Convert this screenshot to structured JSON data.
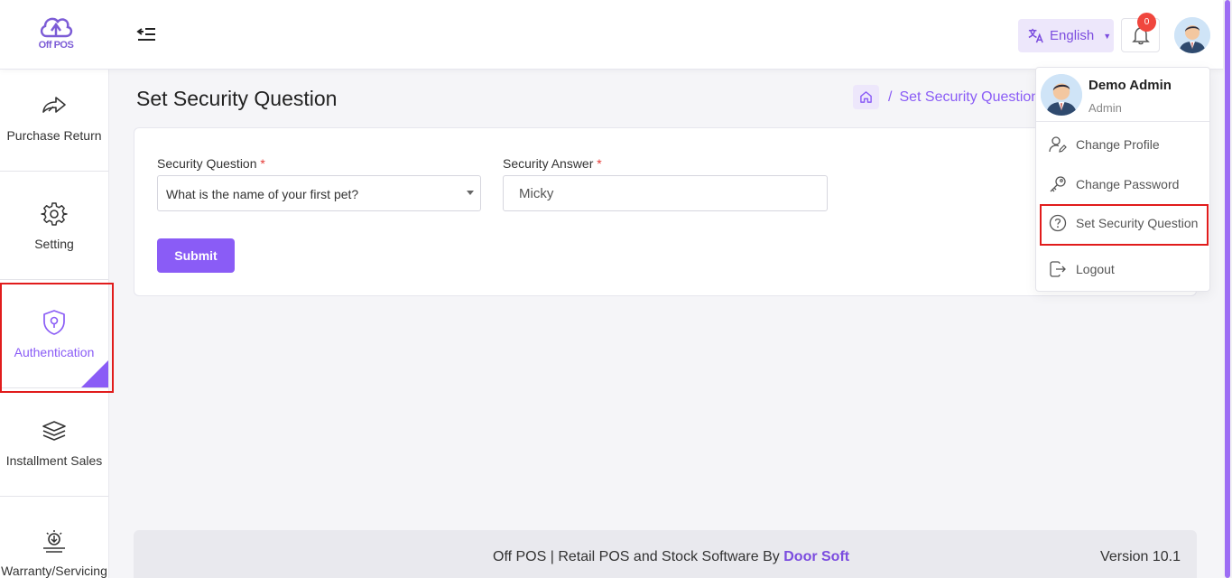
{
  "app": {
    "logo_text": "Off POS"
  },
  "header": {
    "language_label": "English",
    "notification_count": "0"
  },
  "sidebar": {
    "items": [
      {
        "label": "Purchase Return",
        "icon": "share-arrow-icon"
      },
      {
        "label": "Setting",
        "icon": "gear-icon"
      },
      {
        "label": "Authentication",
        "icon": "shield-key-icon",
        "active": true
      },
      {
        "label": "Installment Sales",
        "icon": "coins-stack-icon"
      },
      {
        "label": "Warranty/Servicing",
        "icon": "service-icon"
      }
    ]
  },
  "page": {
    "title": "Set Security Question",
    "breadcrumb_current": "Set Security Question",
    "breadcrumb_separator": "/"
  },
  "form": {
    "question_label": "Security Question",
    "answer_label": "Security Answer",
    "required_mark": "*",
    "question_value": "What is the name of your first pet?",
    "answer_value": "Micky",
    "submit_label": "Submit"
  },
  "footer": {
    "text_prefix": "Off POS | Retail POS and Stock Software By",
    "brand": "Door Soft",
    "version": "Version 10.1"
  },
  "profile_menu": {
    "name": "Demo Admin",
    "role": "Admin",
    "items": [
      {
        "label": "Change Profile",
        "icon": "user-edit-icon"
      },
      {
        "label": "Change Password",
        "icon": "key-icon"
      },
      {
        "label": "Set Security Question",
        "icon": "question-circle-icon"
      },
      {
        "label": "Logout",
        "icon": "logout-icon"
      }
    ]
  },
  "colors": {
    "accent": "#8a5cf6",
    "highlight_box": "#e11c1c",
    "badge": "#f0463d"
  }
}
